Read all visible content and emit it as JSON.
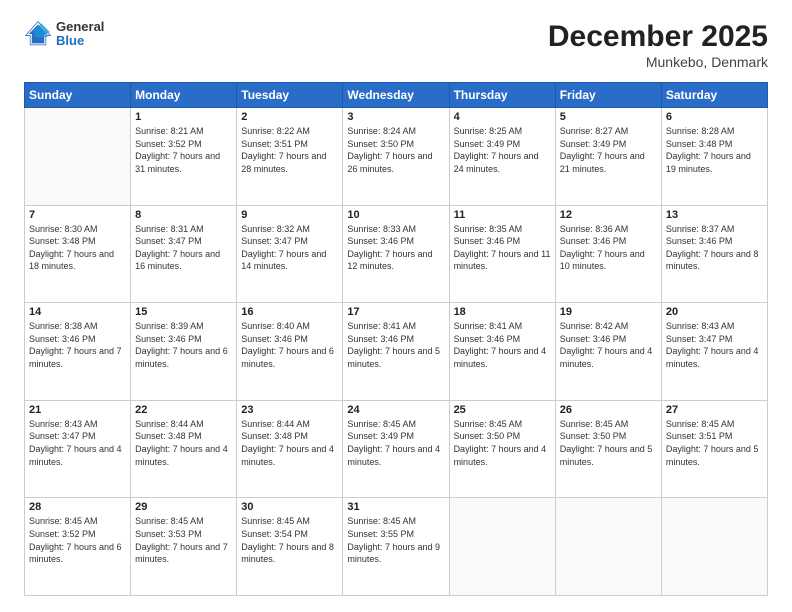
{
  "header": {
    "logo_general": "General",
    "logo_blue": "Blue",
    "month_title": "December 2025",
    "location": "Munkebo, Denmark"
  },
  "weekdays": [
    "Sunday",
    "Monday",
    "Tuesday",
    "Wednesday",
    "Thursday",
    "Friday",
    "Saturday"
  ],
  "weeks": [
    [
      {
        "day": "",
        "sunrise": "",
        "sunset": "",
        "daylight": ""
      },
      {
        "day": "1",
        "sunrise": "Sunrise: 8:21 AM",
        "sunset": "Sunset: 3:52 PM",
        "daylight": "Daylight: 7 hours and 31 minutes."
      },
      {
        "day": "2",
        "sunrise": "Sunrise: 8:22 AM",
        "sunset": "Sunset: 3:51 PM",
        "daylight": "Daylight: 7 hours and 28 minutes."
      },
      {
        "day": "3",
        "sunrise": "Sunrise: 8:24 AM",
        "sunset": "Sunset: 3:50 PM",
        "daylight": "Daylight: 7 hours and 26 minutes."
      },
      {
        "day": "4",
        "sunrise": "Sunrise: 8:25 AM",
        "sunset": "Sunset: 3:49 PM",
        "daylight": "Daylight: 7 hours and 24 minutes."
      },
      {
        "day": "5",
        "sunrise": "Sunrise: 8:27 AM",
        "sunset": "Sunset: 3:49 PM",
        "daylight": "Daylight: 7 hours and 21 minutes."
      },
      {
        "day": "6",
        "sunrise": "Sunrise: 8:28 AM",
        "sunset": "Sunset: 3:48 PM",
        "daylight": "Daylight: 7 hours and 19 minutes."
      }
    ],
    [
      {
        "day": "7",
        "sunrise": "Sunrise: 8:30 AM",
        "sunset": "Sunset: 3:48 PM",
        "daylight": "Daylight: 7 hours and 18 minutes."
      },
      {
        "day": "8",
        "sunrise": "Sunrise: 8:31 AM",
        "sunset": "Sunset: 3:47 PM",
        "daylight": "Daylight: 7 hours and 16 minutes."
      },
      {
        "day": "9",
        "sunrise": "Sunrise: 8:32 AM",
        "sunset": "Sunset: 3:47 PM",
        "daylight": "Daylight: 7 hours and 14 minutes."
      },
      {
        "day": "10",
        "sunrise": "Sunrise: 8:33 AM",
        "sunset": "Sunset: 3:46 PM",
        "daylight": "Daylight: 7 hours and 12 minutes."
      },
      {
        "day": "11",
        "sunrise": "Sunrise: 8:35 AM",
        "sunset": "Sunset: 3:46 PM",
        "daylight": "Daylight: 7 hours and 11 minutes."
      },
      {
        "day": "12",
        "sunrise": "Sunrise: 8:36 AM",
        "sunset": "Sunset: 3:46 PM",
        "daylight": "Daylight: 7 hours and 10 minutes."
      },
      {
        "day": "13",
        "sunrise": "Sunrise: 8:37 AM",
        "sunset": "Sunset: 3:46 PM",
        "daylight": "Daylight: 7 hours and 8 minutes."
      }
    ],
    [
      {
        "day": "14",
        "sunrise": "Sunrise: 8:38 AM",
        "sunset": "Sunset: 3:46 PM",
        "daylight": "Daylight: 7 hours and 7 minutes."
      },
      {
        "day": "15",
        "sunrise": "Sunrise: 8:39 AM",
        "sunset": "Sunset: 3:46 PM",
        "daylight": "Daylight: 7 hours and 6 minutes."
      },
      {
        "day": "16",
        "sunrise": "Sunrise: 8:40 AM",
        "sunset": "Sunset: 3:46 PM",
        "daylight": "Daylight: 7 hours and 6 minutes."
      },
      {
        "day": "17",
        "sunrise": "Sunrise: 8:41 AM",
        "sunset": "Sunset: 3:46 PM",
        "daylight": "Daylight: 7 hours and 5 minutes."
      },
      {
        "day": "18",
        "sunrise": "Sunrise: 8:41 AM",
        "sunset": "Sunset: 3:46 PM",
        "daylight": "Daylight: 7 hours and 4 minutes."
      },
      {
        "day": "19",
        "sunrise": "Sunrise: 8:42 AM",
        "sunset": "Sunset: 3:46 PM",
        "daylight": "Daylight: 7 hours and 4 minutes."
      },
      {
        "day": "20",
        "sunrise": "Sunrise: 8:43 AM",
        "sunset": "Sunset: 3:47 PM",
        "daylight": "Daylight: 7 hours and 4 minutes."
      }
    ],
    [
      {
        "day": "21",
        "sunrise": "Sunrise: 8:43 AM",
        "sunset": "Sunset: 3:47 PM",
        "daylight": "Daylight: 7 hours and 4 minutes."
      },
      {
        "day": "22",
        "sunrise": "Sunrise: 8:44 AM",
        "sunset": "Sunset: 3:48 PM",
        "daylight": "Daylight: 7 hours and 4 minutes."
      },
      {
        "day": "23",
        "sunrise": "Sunrise: 8:44 AM",
        "sunset": "Sunset: 3:48 PM",
        "daylight": "Daylight: 7 hours and 4 minutes."
      },
      {
        "day": "24",
        "sunrise": "Sunrise: 8:45 AM",
        "sunset": "Sunset: 3:49 PM",
        "daylight": "Daylight: 7 hours and 4 minutes."
      },
      {
        "day": "25",
        "sunrise": "Sunrise: 8:45 AM",
        "sunset": "Sunset: 3:50 PM",
        "daylight": "Daylight: 7 hours and 4 minutes."
      },
      {
        "day": "26",
        "sunrise": "Sunrise: 8:45 AM",
        "sunset": "Sunset: 3:50 PM",
        "daylight": "Daylight: 7 hours and 5 minutes."
      },
      {
        "day": "27",
        "sunrise": "Sunrise: 8:45 AM",
        "sunset": "Sunset: 3:51 PM",
        "daylight": "Daylight: 7 hours and 5 minutes."
      }
    ],
    [
      {
        "day": "28",
        "sunrise": "Sunrise: 8:45 AM",
        "sunset": "Sunset: 3:52 PM",
        "daylight": "Daylight: 7 hours and 6 minutes."
      },
      {
        "day": "29",
        "sunrise": "Sunrise: 8:45 AM",
        "sunset": "Sunset: 3:53 PM",
        "daylight": "Daylight: 7 hours and 7 minutes."
      },
      {
        "day": "30",
        "sunrise": "Sunrise: 8:45 AM",
        "sunset": "Sunset: 3:54 PM",
        "daylight": "Daylight: 7 hours and 8 minutes."
      },
      {
        "day": "31",
        "sunrise": "Sunrise: 8:45 AM",
        "sunset": "Sunset: 3:55 PM",
        "daylight": "Daylight: 7 hours and 9 minutes."
      },
      {
        "day": "",
        "sunrise": "",
        "sunset": "",
        "daylight": ""
      },
      {
        "day": "",
        "sunrise": "",
        "sunset": "",
        "daylight": ""
      },
      {
        "day": "",
        "sunrise": "",
        "sunset": "",
        "daylight": ""
      }
    ]
  ]
}
